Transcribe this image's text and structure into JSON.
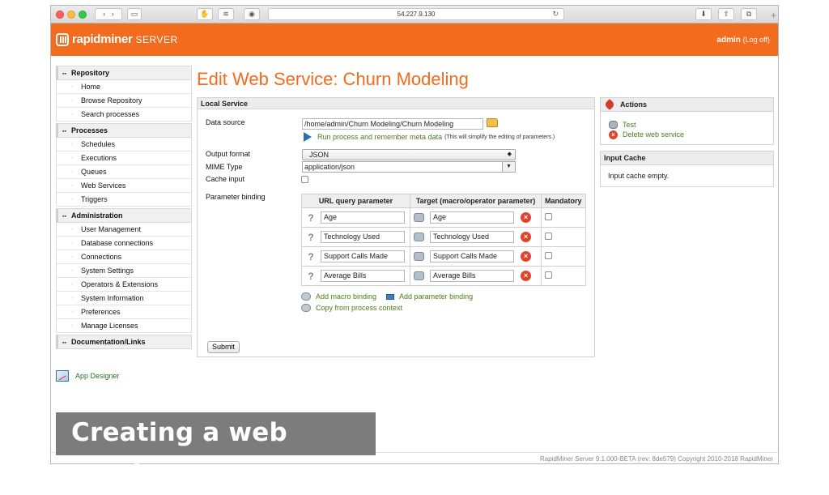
{
  "browser": {
    "url": "54.227.9.130",
    "reload_glyph": "↻"
  },
  "header": {
    "brand": "rapidminer",
    "product": "SERVER",
    "user": "admin",
    "logoff": "(Log off)"
  },
  "sidebar": {
    "sections": [
      {
        "title": "Repository",
        "items": [
          "Home",
          "Browse Repository",
          "Search processes"
        ]
      },
      {
        "title": "Processes",
        "items": [
          "Schedules",
          "Executions",
          "Queues",
          "Web Services",
          "Triggers"
        ]
      },
      {
        "title": "Administration",
        "items": [
          "User Management",
          "Database connections",
          "Connections",
          "System Settings",
          "Operators & Extensions",
          "System Information",
          "Preferences",
          "Manage Licenses"
        ]
      },
      {
        "title": "Documentation/Links",
        "items": []
      }
    ],
    "app_designer": "App Designer"
  },
  "main": {
    "title": "Edit Web Service: Churn Modeling",
    "panel_title": "Local Service",
    "data_source_label": "Data source",
    "data_source_value": "/home/admin/Churn Modeling/Churn Modeling",
    "run_link": "Run process and remember meta data",
    "run_note": "(This will simplify the editing of parameters.)",
    "output_format_label": "Output format",
    "output_format_value": "JSON",
    "mime_label": "MIME Type",
    "mime_value": "application/json",
    "cache_label": "Cache input",
    "param_label": "Parameter binding",
    "table": {
      "headers": [
        "URL query parameter",
        "Target (macro/operator parameter)",
        "Mandatory"
      ],
      "rows": [
        {
          "query": "Age",
          "target": "Age"
        },
        {
          "query": "Technology Used",
          "target": "Technology Used"
        },
        {
          "query": "Support Calls Made",
          "target": "Support Calls Made"
        },
        {
          "query": "Average Bills",
          "target": "Average Bills"
        }
      ]
    },
    "add_macro": "Add macro binding",
    "add_param": "Add parameter binding",
    "copy_context": "Copy from process context",
    "submit": "Submit"
  },
  "actions": {
    "title": "Actions",
    "test": "Test",
    "delete": "Delete web service"
  },
  "cache": {
    "title": "Input Cache",
    "status": "Input cache empty."
  },
  "footer": "RapidMiner Server 9.1.000-BETA (rev: 8de579) Copyright 2010-2018 RapidMiner",
  "caption": "Creating a web service"
}
